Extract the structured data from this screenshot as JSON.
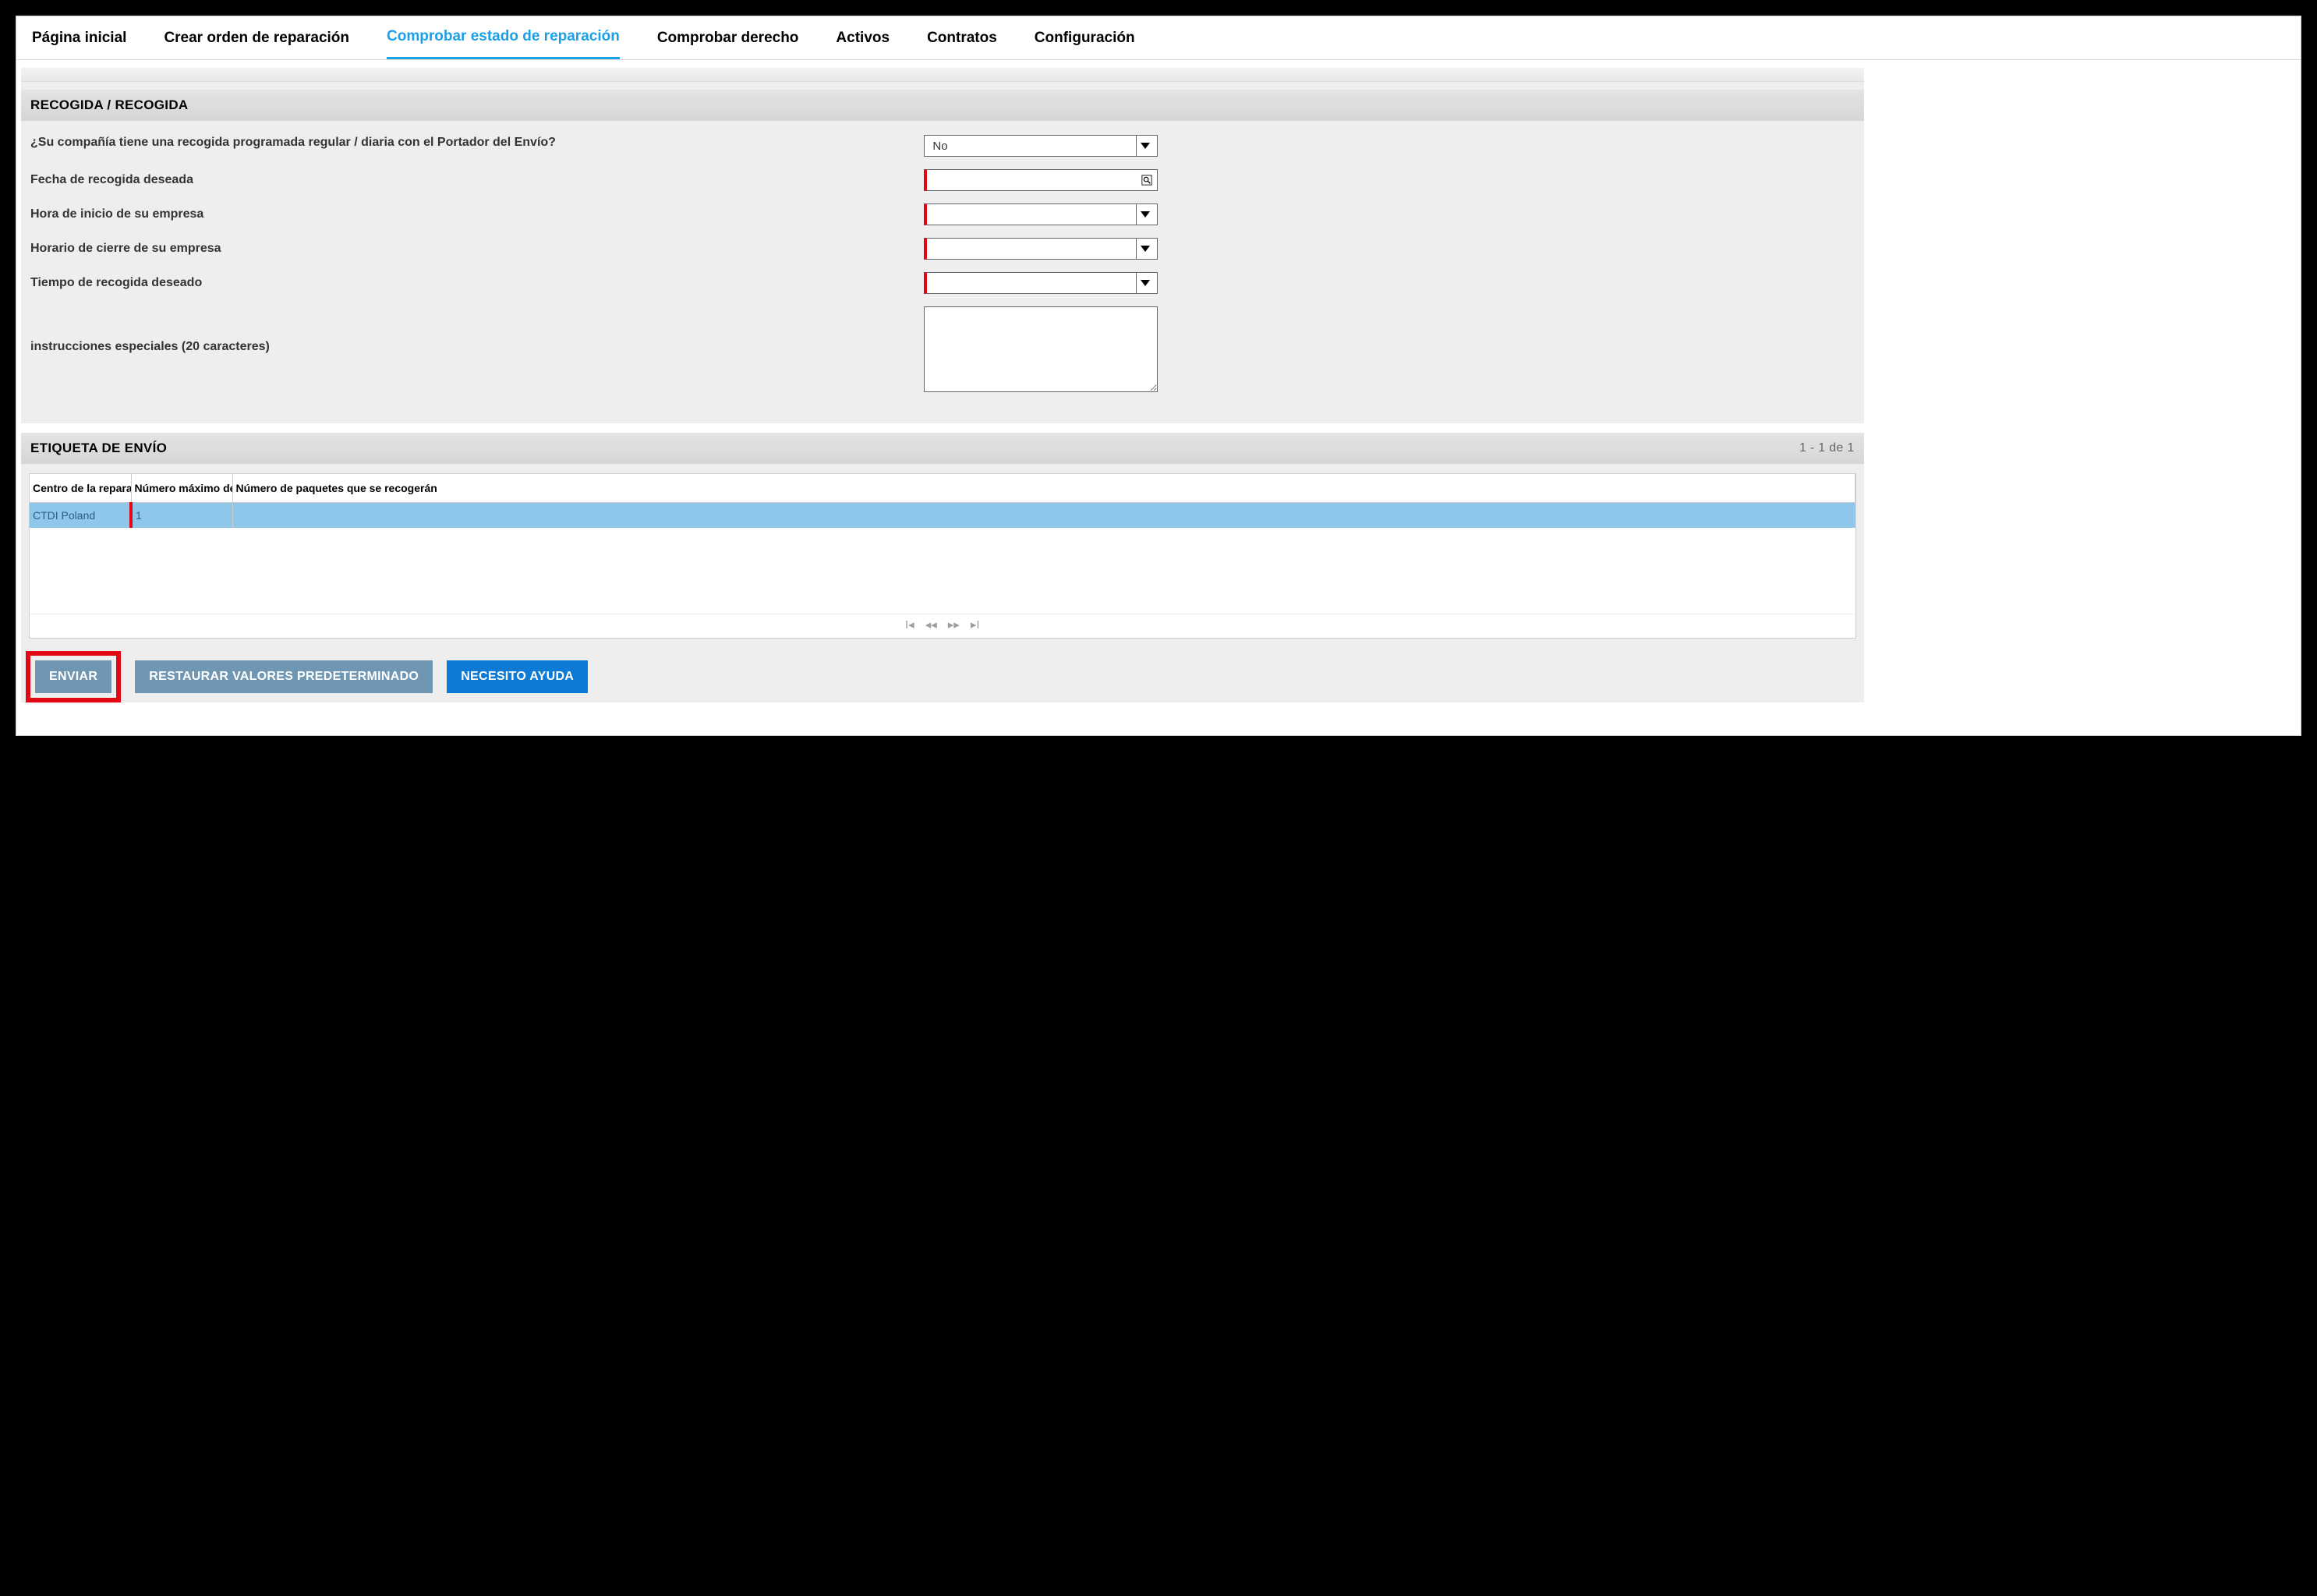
{
  "nav": {
    "items": [
      {
        "label": "Página inicial",
        "active": false
      },
      {
        "label": "Crear orden de reparación",
        "active": false
      },
      {
        "label": "Comprobar estado de reparación",
        "active": true
      },
      {
        "label": "Comprobar derecho",
        "active": false
      },
      {
        "label": "Activos",
        "active": false
      },
      {
        "label": "Contratos",
        "active": false
      },
      {
        "label": "Configuración",
        "active": false
      }
    ]
  },
  "pickup_panel": {
    "title": "RECOGIDA / RECOGIDA",
    "fields": {
      "company_pickup_q": "¿Su compañía tiene una recogida programada regular / diaria con el Portador del Envío?",
      "company_pickup_val": "No",
      "desired_date_label": "Fecha de recogida deseada",
      "desired_date_val": "",
      "open_time_label": "Hora de inicio de su empresa",
      "open_time_val": "",
      "close_time_label": "Horario de cierre de su empresa",
      "close_time_val": "",
      "desired_time_label": "Tiempo de recogida deseado",
      "desired_time_val": "",
      "special_label": "instrucciones especiales (20 caracteres)",
      "special_val": ""
    }
  },
  "label_panel": {
    "title": "ETIQUETA DE ENVÍO",
    "count_text": "1 - 1 de 1",
    "columns": {
      "c1": "Centro de la repara",
      "c2": "Número máximo de",
      "c3": "Número de paquetes que se recogerán"
    },
    "row": {
      "center": "CTDI Poland",
      "max": "1",
      "packages": ""
    }
  },
  "buttons": {
    "send": "ENVIAR",
    "restore": "RESTAURAR VALORES PREDETERMINADO",
    "help": "NECESITO AYUDA"
  },
  "pager_icons": {
    "first": "❘◀",
    "prev": "◀◀",
    "next": "▶▶",
    "last": "▶❘"
  }
}
